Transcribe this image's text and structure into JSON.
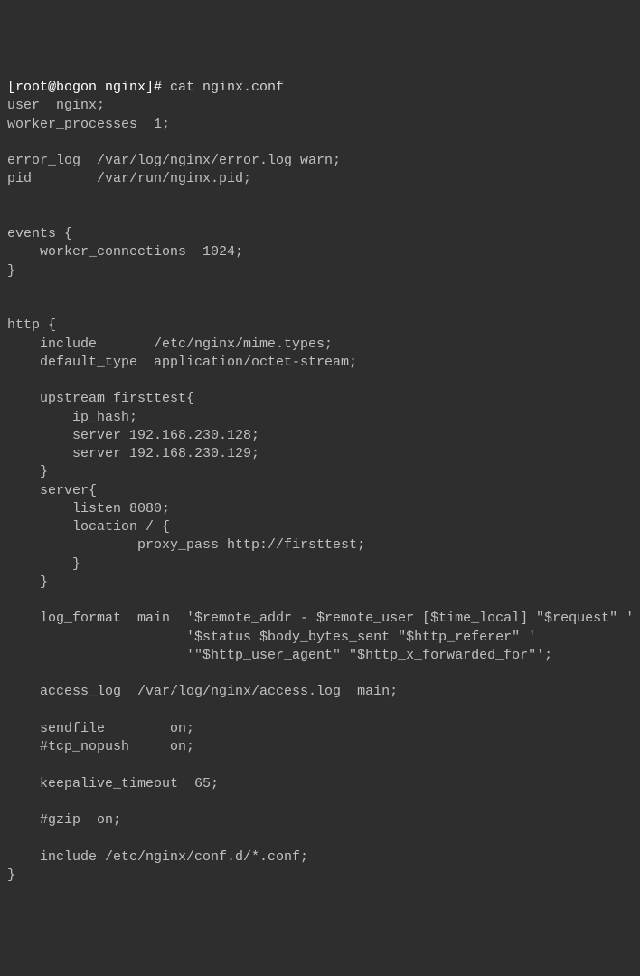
{
  "terminal": {
    "prompt": "[root@bogon nginx]# ",
    "command": "cat nginx.conf",
    "output": "\nuser  nginx;\nworker_processes  1;\n\nerror_log  /var/log/nginx/error.log warn;\npid        /var/run/nginx.pid;\n\n\nevents {\n    worker_connections  1024;\n}\n\n\nhttp {\n    include       /etc/nginx/mime.types;\n    default_type  application/octet-stream;\n\n    upstream firsttest{\n        ip_hash;\n        server 192.168.230.128;\n        server 192.168.230.129;\n    }\n    server{\n        listen 8080;\n        location / {\n                proxy_pass http://firsttest;\n        }\n    }\n\n    log_format  main  '$remote_addr - $remote_user [$time_local] \"$request\" '\n                      '$status $body_bytes_sent \"$http_referer\" '\n                      '\"$http_user_agent\" \"$http_x_forwarded_for\"';\n\n    access_log  /var/log/nginx/access.log  main;\n\n    sendfile        on;\n    #tcp_nopush     on;\n\n    keepalive_timeout  65;\n\n    #gzip  on;\n\n    include /etc/nginx/conf.d/*.conf;\n}"
  }
}
